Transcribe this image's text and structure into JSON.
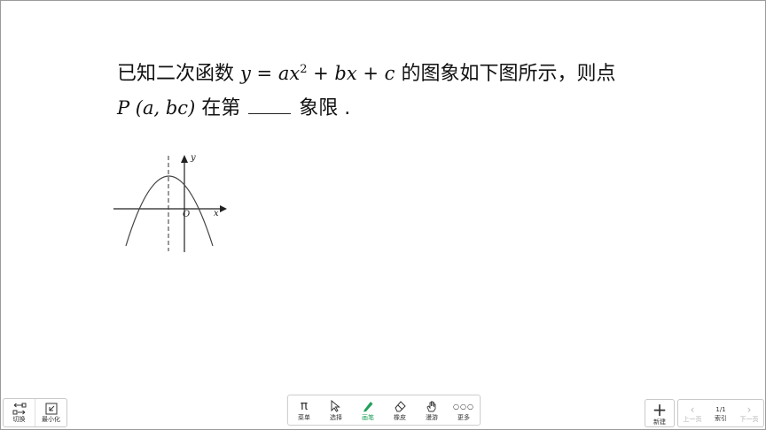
{
  "question": {
    "prefix": "已知二次函数",
    "equation_y": "y = ax",
    "equation_exp": "2",
    "equation_rest": " + bx + c",
    "suffix": "的图象如下图所示，则点",
    "point": "P (a, bc)",
    "line2_mid": "在第",
    "line2_end": "象限 ."
  },
  "graph": {
    "y_label": "y",
    "x_label": "x",
    "origin_label": "O"
  },
  "bottom_left": {
    "switch_label": "切换",
    "minimize_label": "最小化"
  },
  "toolbar": {
    "tools": [
      {
        "label": "菜单",
        "icon": "pi-icon",
        "glyph": "π"
      },
      {
        "label": "选择",
        "icon": "cursor-icon"
      },
      {
        "label": "画笔",
        "icon": "pen-icon",
        "active": true
      },
      {
        "label": "橡皮",
        "icon": "eraser-icon"
      },
      {
        "label": "漫游",
        "icon": "hand-icon"
      },
      {
        "label": "更多",
        "icon": "more-icon",
        "glyph": "○○○"
      }
    ],
    "active_color": "#22a05a"
  },
  "new_page": {
    "label": "新建"
  },
  "pager": {
    "prev_label": "上一页",
    "count": "1/1",
    "index_label": "索引",
    "next_label": "下一页"
  }
}
